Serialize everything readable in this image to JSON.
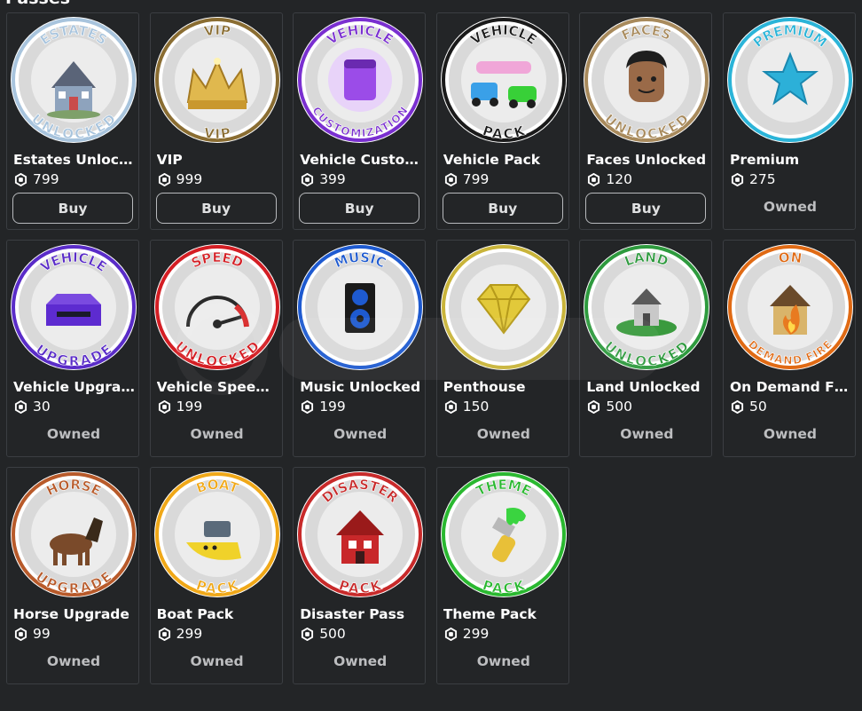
{
  "section_title": "Passes",
  "colors": {
    "background": "#232527",
    "card_border": "#3b3e42",
    "owned_text": "#bdbec0"
  },
  "passes": [
    {
      "name": "Estates Unlocked",
      "price": "799",
      "status": "Buy",
      "badge_top": "ESTATES",
      "badge_bottom": "UNLOCKED",
      "ring": "#a8c4dd",
      "art": "house-icon",
      "art_color": "#8ea3bd"
    },
    {
      "name": "VIP",
      "price": "999",
      "status": "Buy",
      "badge_top": "VIP",
      "badge_bottom": "VIP",
      "ring": "#8a6d32",
      "art": "crown-icon",
      "art_color": "#e0b84e"
    },
    {
      "name": "Vehicle Customization",
      "price": "399",
      "status": "Buy",
      "badge_top": "VEHICLE",
      "badge_bottom": "CUSTOMIZATION",
      "ring": "#7a2fd0",
      "art": "paint-bucket-icon",
      "art_color": "#9b4ce8"
    },
    {
      "name": "Vehicle Pack",
      "price": "799",
      "status": "Buy",
      "badge_top": "VEHICLE",
      "badge_bottom": "PACK",
      "ring": "#1a1a1a",
      "art": "car-icon",
      "art_color": "#3aa0e8"
    },
    {
      "name": "Faces Unlocked",
      "price": "120",
      "status": "Buy",
      "badge_top": "FACES",
      "badge_bottom": "UNLOCKED",
      "ring": "#a88a5c",
      "art": "face-icon",
      "art_color": "#9a6a48"
    },
    {
      "name": "Premium",
      "price": "275",
      "status": "Owned",
      "badge_top": "PREMIUM",
      "badge_bottom": "",
      "ring": "#2bb4d8",
      "art": "star-icon",
      "art_color": "#2cb0d8"
    },
    {
      "name": "Vehicle Upgrade",
      "price": "30",
      "status": "Owned",
      "badge_top": "VEHICLE",
      "badge_bottom": "UPGRADE",
      "ring": "#5a2cc8",
      "art": "upgrade-box-icon",
      "art_color": "#5d2bd0"
    },
    {
      "name": "Vehicle Speed Unlocked",
      "price": "199",
      "status": "Owned",
      "badge_top": "SPEED",
      "badge_bottom": "UNLOCKED",
      "ring": "#d41e24",
      "art": "speedometer-icon",
      "art_color": "#d82828"
    },
    {
      "name": "Music Unlocked",
      "price": "199",
      "status": "Owned",
      "badge_top": "MUSIC",
      "badge_bottom": "",
      "ring": "#1e5ad0",
      "art": "speaker-icon",
      "art_color": "#1a1a1a"
    },
    {
      "name": "Penthouse",
      "price": "150",
      "status": "Owned",
      "badge_top": "",
      "badge_bottom": "",
      "ring": "#c9b43a",
      "art": "diamond-icon",
      "art_color": "#e2c93a"
    },
    {
      "name": "Land Unlocked",
      "price": "500",
      "status": "Owned",
      "badge_top": "LAND",
      "badge_bottom": "UNLOCKED",
      "ring": "#2e9a3e",
      "art": "land-house-icon",
      "art_color": "#3a9a3e"
    },
    {
      "name": "On Demand Fire",
      "price": "50",
      "status": "Owned",
      "badge_top": "ON",
      "badge_bottom": "DEMAND FIRE",
      "ring": "#e06a14",
      "art": "fire-house-icon",
      "art_color": "#e87a20"
    },
    {
      "name": "Horse Upgrade",
      "price": "99",
      "status": "Owned",
      "badge_top": "HORSE",
      "badge_bottom": "UPGRADE",
      "ring": "#b85a2a",
      "art": "horse-icon",
      "art_color": "#7a4a2a"
    },
    {
      "name": "Boat Pack",
      "price": "299",
      "status": "Owned",
      "badge_top": "BOAT",
      "badge_bottom": "PACK",
      "ring": "#f0a818",
      "art": "boat-icon",
      "art_color": "#f0d22a"
    },
    {
      "name": "Disaster Pass",
      "price": "500",
      "status": "Owned",
      "badge_top": "DISASTER",
      "badge_bottom": "PACK",
      "ring": "#c82a2a",
      "art": "disaster-house-icon",
      "art_color": "#c8282a"
    },
    {
      "name": "Theme Pack",
      "price": "299",
      "status": "Owned",
      "badge_top": "THEME",
      "badge_bottom": "PACK",
      "ring": "#2ab830",
      "art": "paintbrush-icon",
      "art_color": "#3ad440"
    }
  ]
}
